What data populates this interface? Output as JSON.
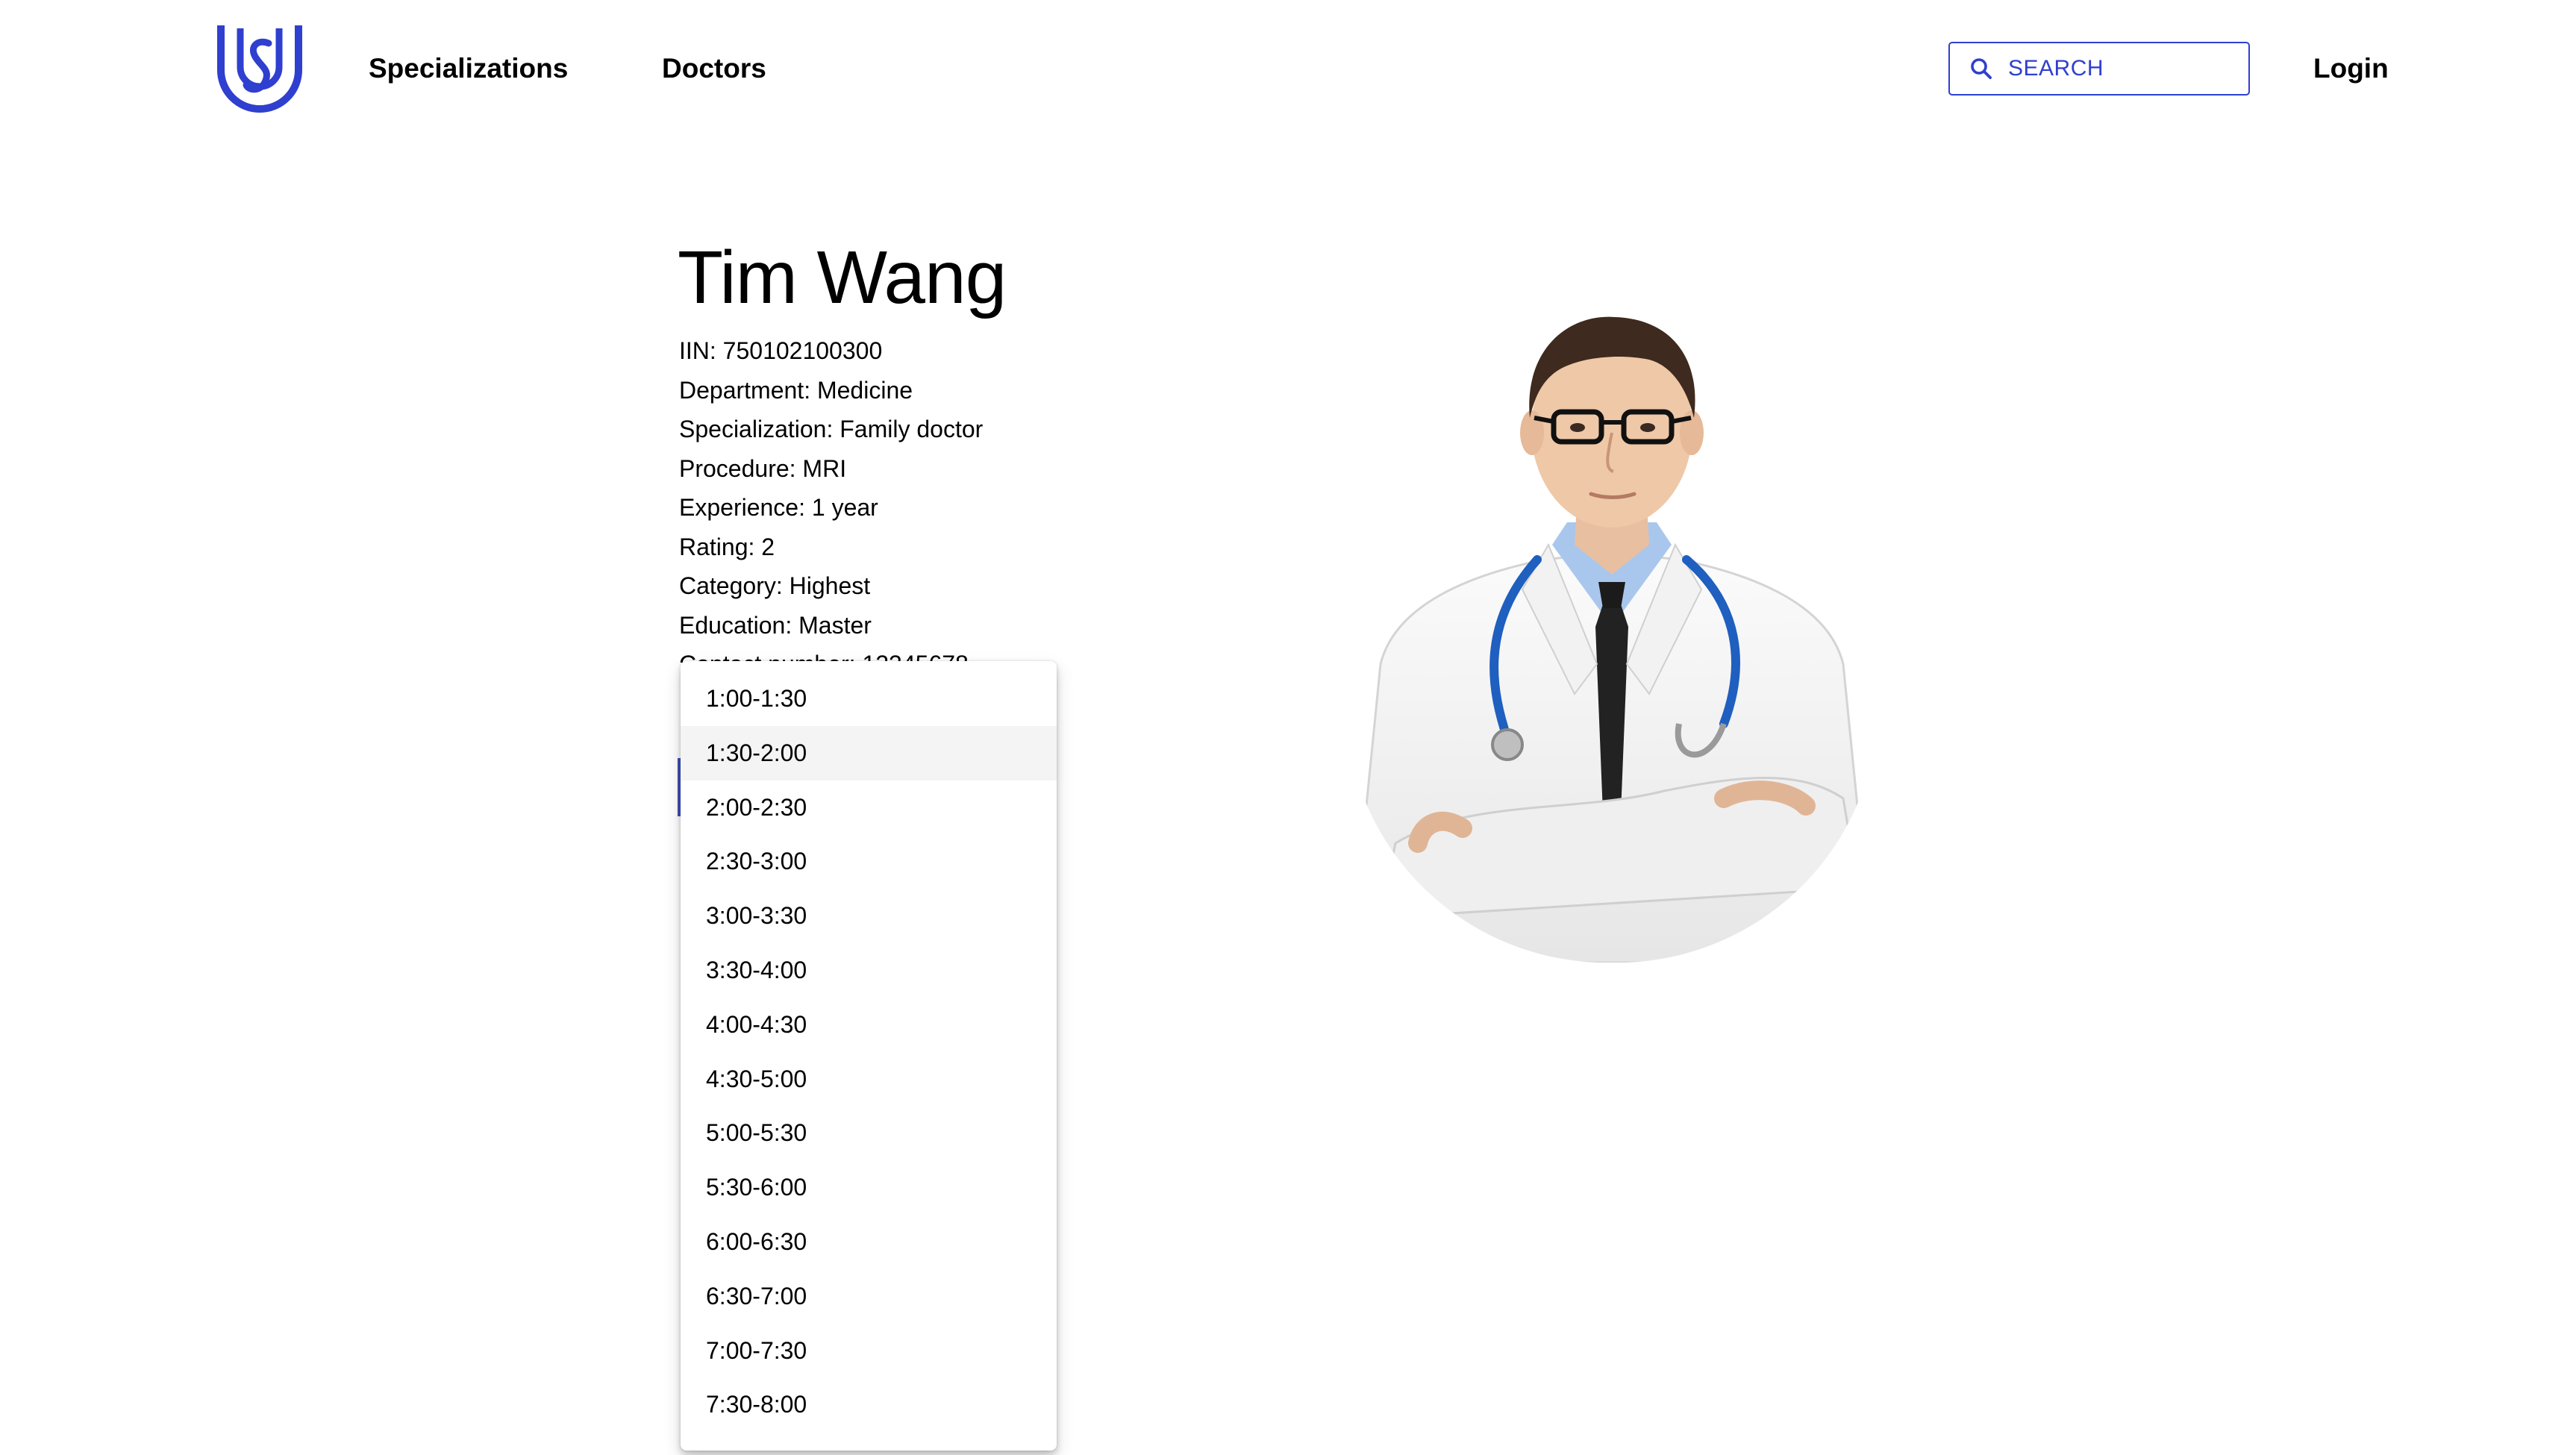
{
  "header": {
    "logo_icon": "shield-s-logo-icon",
    "nav": [
      "Specializations",
      "Doctors"
    ],
    "search_placeholder": "SEARCH",
    "search_icon": "search-icon",
    "login_label": "Login",
    "accent_color": "#2f3fcf"
  },
  "doctor": {
    "name": "Tim Wang",
    "details": [
      "IIN: 750102100300",
      "Department: Medicine",
      "Specialization: Family doctor",
      "Procedure: MRI",
      "Experience: 1 year",
      "Rating: 2",
      "Category: Highest",
      "Education: Master",
      "Contact number: 12345678"
    ],
    "photo_icon": "doctor-portrait-image"
  },
  "time_dropdown": {
    "highlighted_index": 1,
    "options": [
      "1:00-1:30",
      "1:30-2:00",
      "2:00-2:30",
      "2:30-3:00",
      "3:00-3:30",
      "3:30-4:00",
      "4:00-4:30",
      "4:30-5:00",
      "5:00-5:30",
      "5:30-6:00",
      "6:00-6:30",
      "6:30-7:00",
      "7:00-7:30",
      "7:30-8:00"
    ]
  }
}
